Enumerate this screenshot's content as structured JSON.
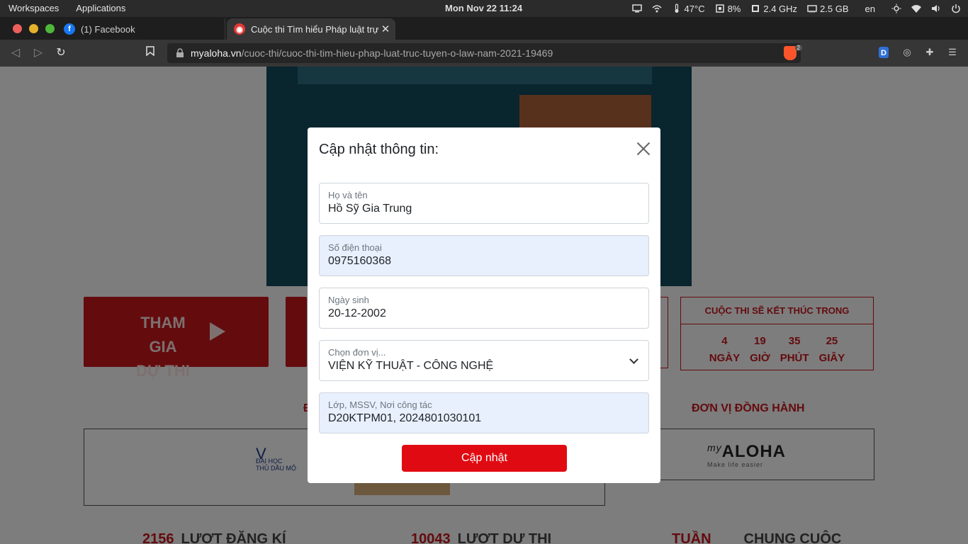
{
  "system_bar": {
    "workspaces": "Workspaces",
    "applications": "Applications",
    "datetime": "Mon Nov 22  11:24",
    "temperature": "47°C",
    "cpu": "8%",
    "cpu_freq": "2.4 GHz",
    "memory": "2.5 GB",
    "language": "en"
  },
  "tabs": [
    {
      "title": "(1) Facebook",
      "favicon": "facebook-icon"
    },
    {
      "title": "Cuộc thi Tìm hiểu Pháp luật trực",
      "favicon": "myaloha-icon"
    }
  ],
  "address_bar": {
    "host": "myaloha.vn",
    "path": "/cuoc-thi/cuoc-thi-tim-hieu-phap-luat-truc-tuyen-o-law-nam-2021-19469",
    "shields_count": "2"
  },
  "page": {
    "join_button": {
      "line1": "THAM GIA",
      "line2": "DỰ THI"
    },
    "countdown": {
      "title": "CUỘC THI SẼ KẾT THÚC TRONG",
      "units": [
        {
          "value": "4",
          "label": "NGÀY"
        },
        {
          "value": "19",
          "label": "GIỜ"
        },
        {
          "value": "35",
          "label": "PHÚT"
        },
        {
          "value": "25",
          "label": "GIÂY"
        }
      ]
    },
    "organizer_title_fragment": "Đ",
    "companion_title": "ĐƠN VỊ ĐỒNG HÀNH",
    "sponsor_logo": {
      "brand": "ALOHA",
      "script": "my",
      "tagline": "Make life easier"
    },
    "organizer_logo_text": {
      "line1": "ĐẠI HỌC",
      "line2": "THỦ DẦU MỘ"
    },
    "stats": [
      {
        "number": "2156",
        "label": "LƯỢT ĐĂNG KÍ"
      },
      {
        "number": "10043",
        "label": "LƯỢT DỰ THI"
      },
      {
        "number": "TUẦN",
        "label": "CHUNG CUỘC"
      }
    ]
  },
  "modal": {
    "title": "Cập nhật thông tin:",
    "fields": {
      "full_name": {
        "label": "Họ và tên",
        "value": "Hồ Sỹ Gia Trung"
      },
      "phone": {
        "label": "Số điện thoại",
        "value": "0975160368"
      },
      "birthday": {
        "label": "Ngày sinh",
        "value": "20-12-2002"
      },
      "unit": {
        "label": "Chọn đơn vị...",
        "value": "VIỆN KỸ THUẬT - CÔNG NGHỆ"
      },
      "class_info": {
        "label": "Lớp, MSSV, Nơi công tác",
        "value": "D20KTPM01, 2024801030101"
      }
    },
    "submit_label": "Cập nhật"
  }
}
